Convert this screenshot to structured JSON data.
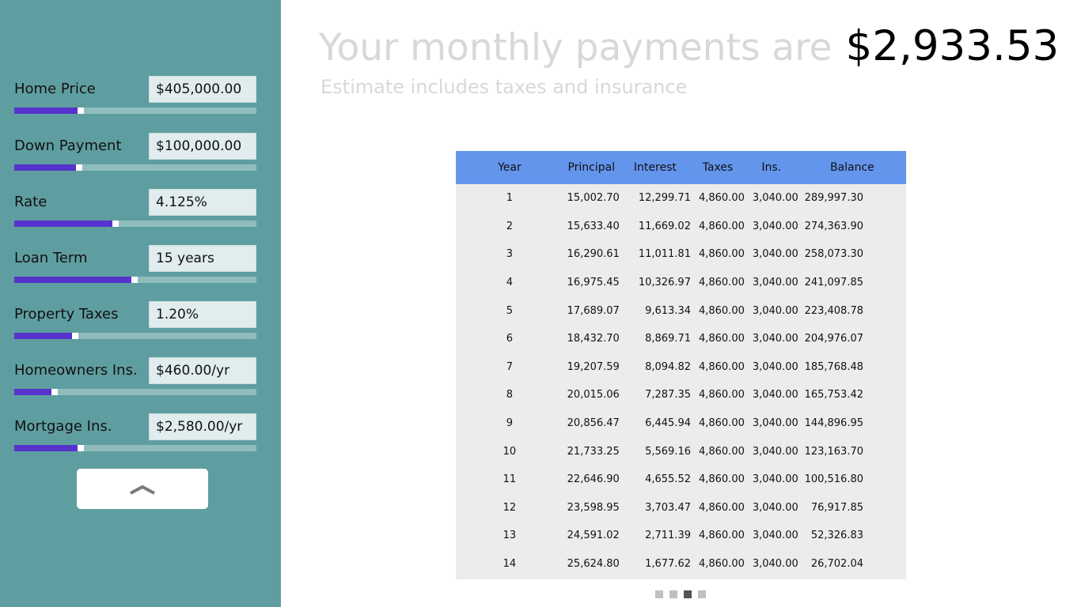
{
  "sidebar": {
    "fields": [
      {
        "label": "Home Price",
        "value": "$405,000.00",
        "level": 0.26
      },
      {
        "label": "Down Payment",
        "value": "$100,000.00",
        "level": 0.255
      },
      {
        "label": "Rate",
        "value": "4.125%",
        "level": 0.405
      },
      {
        "label": "Loan Term",
        "value": "15 years",
        "level": 0.485
      },
      {
        "label": "Property Taxes",
        "value": "1.20%",
        "level": 0.24
      },
      {
        "label": "Homeowners Ins.",
        "value": "$460.00/yr",
        "level": 0.155
      },
      {
        "label": "Mortgage Ins.",
        "value": "$2,580.00/yr",
        "level": 0.26
      }
    ],
    "collapse_icon": "chevron-up-icon"
  },
  "header": {
    "prefix": "Your monthly payments are",
    "amount": "$2,933.53",
    "subtitle": "Estimate includes taxes and insurance"
  },
  "table": {
    "columns": [
      "Year",
      "Principal",
      "Interest",
      "Taxes",
      "Ins.",
      "Balance"
    ],
    "rows": [
      [
        "1",
        "15,002.70",
        "12,299.71",
        "4,860.00",
        "3,040.00",
        "289,997.30"
      ],
      [
        "2",
        "15,633.40",
        "11,669.02",
        "4,860.00",
        "3,040.00",
        "274,363.90"
      ],
      [
        "3",
        "16,290.61",
        "11,011.81",
        "4,860.00",
        "3,040.00",
        "258,073.30"
      ],
      [
        "4",
        "16,975.45",
        "10,326.97",
        "4,860.00",
        "3,040.00",
        "241,097.85"
      ],
      [
        "5",
        "17,689.07",
        "9,613.34",
        "4,860.00",
        "3,040.00",
        "223,408.78"
      ],
      [
        "6",
        "18,432.70",
        "8,869.71",
        "4,860.00",
        "3,040.00",
        "204,976.07"
      ],
      [
        "7",
        "19,207.59",
        "8,094.82",
        "4,860.00",
        "3,040.00",
        "185,768.48"
      ],
      [
        "8",
        "20,015.06",
        "7,287.35",
        "4,860.00",
        "3,040.00",
        "165,753.42"
      ],
      [
        "9",
        "20,856.47",
        "6,445.94",
        "4,860.00",
        "3,040.00",
        "144,896.95"
      ],
      [
        "10",
        "21,733.25",
        "5,569.16",
        "4,860.00",
        "3,040.00",
        "123,163.70"
      ],
      [
        "11",
        "22,646.90",
        "4,655.52",
        "4,860.00",
        "3,040.00",
        "100,516.80"
      ],
      [
        "12",
        "23,598.95",
        "3,703.47",
        "4,860.00",
        "3,040.00",
        "76,917.85"
      ],
      [
        "13",
        "24,591.02",
        "2,711.39",
        "4,860.00",
        "3,040.00",
        "52,326.83"
      ],
      [
        "14",
        "25,624.80",
        "1,677.62",
        "4,860.00",
        "3,040.00",
        "26,702.04"
      ]
    ]
  },
  "pager": {
    "count": 4,
    "active_index": 2
  },
  "colors": {
    "sidebar_bg": "#5f9ea0",
    "slider_fill": "#5533cc",
    "table_header": "#6495ed",
    "table_body": "#ececec"
  }
}
